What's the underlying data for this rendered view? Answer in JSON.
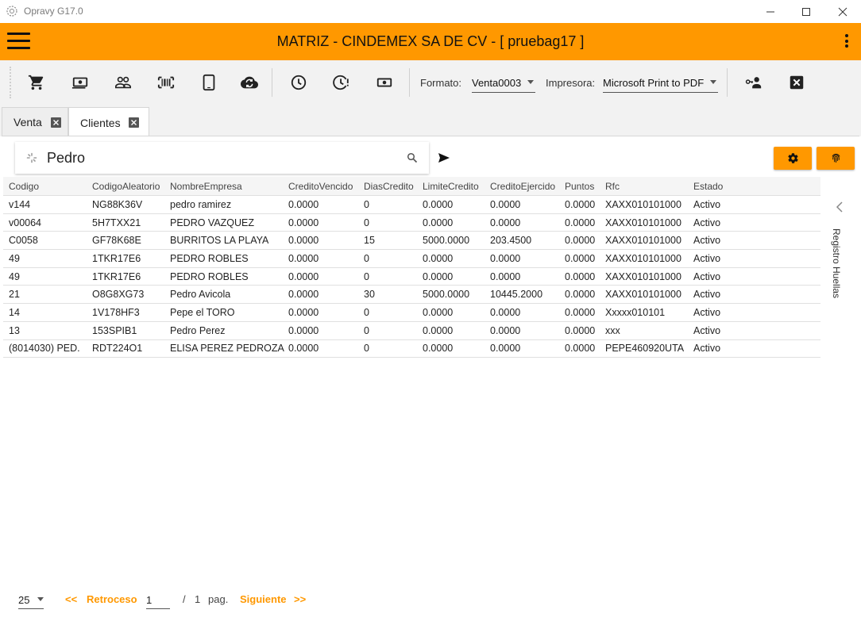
{
  "window": {
    "title": "Opravy G17.0"
  },
  "header": {
    "title": "MATRIZ - CINDEMEX SA DE CV - [ pruebag17 ]"
  },
  "toolbar": {
    "formato_label": "Formato:",
    "formato_value": "Venta0003",
    "impresora_label": "Impresora:",
    "impresora_value": "Microsoft Print to PDF"
  },
  "tabs": [
    {
      "label": "Venta",
      "active": false
    },
    {
      "label": "Clientes",
      "active": true
    }
  ],
  "search": {
    "value": "Pedro",
    "placeholder": ""
  },
  "table": {
    "columns": [
      "Codigo",
      "CodigoAleatorio",
      "NombreEmpresa",
      "CreditoVencido",
      "DiasCredito",
      "LimiteCredito",
      "CreditoEjercido",
      "Puntos",
      "Rfc",
      "Estado"
    ],
    "rows": [
      [
        "v144",
        "NG88K36V",
        "pedro ramirez",
        "0.0000",
        "0",
        "0.0000",
        "0.0000",
        "0.0000",
        "XAXX010101000",
        "Activo"
      ],
      [
        "v00064",
        "5H7TXX21",
        "PEDRO VAZQUEZ",
        "0.0000",
        "0",
        "0.0000",
        "0.0000",
        "0.0000",
        "XAXX010101000",
        "Activo"
      ],
      [
        "C0058",
        "GF78K68E",
        "BURRITOS LA PLAYA",
        "0.0000",
        "15",
        "5000.0000",
        "203.4500",
        "0.0000",
        "XAXX010101000",
        "Activo"
      ],
      [
        "49",
        "1TKR17E6",
        "PEDRO ROBLES",
        "0.0000",
        "0",
        "0.0000",
        "0.0000",
        "0.0000",
        "XAXX010101000",
        "Activo"
      ],
      [
        "49",
        "1TKR17E6",
        "PEDRO ROBLES",
        "0.0000",
        "0",
        "0.0000",
        "0.0000",
        "0.0000",
        "XAXX010101000",
        "Activo"
      ],
      [
        "21",
        "O8G8XG73",
        "Pedro Avicola",
        "0.0000",
        "30",
        "5000.0000",
        "10445.2000",
        "0.0000",
        "XAXX010101000",
        "Activo"
      ],
      [
        "14",
        "1V178HF3",
        "Pepe el TORO",
        "0.0000",
        "0",
        "0.0000",
        "0.0000",
        "0.0000",
        "Xxxxx010101",
        "Activo"
      ],
      [
        "13",
        "153SPIB1",
        "Pedro Perez",
        "0.0000",
        "0",
        "0.0000",
        "0.0000",
        "0.0000",
        "xxx",
        "Activo"
      ],
      [
        "(8014030) PED.",
        "RDT224O1",
        "ELISA PEREZ PEDROZA",
        "0.0000",
        "0",
        "0.0000",
        "0.0000",
        "0.0000",
        "PEPE460920UTA",
        "Activo"
      ]
    ]
  },
  "side_panel": {
    "label": "Registro Huellas"
  },
  "pagination": {
    "page_size": "25",
    "prev_arrows": "<<",
    "prev_label": "Retroceso",
    "current_page": "1",
    "of_label": "/",
    "total_pages": "1",
    "pag_label": "pag.",
    "next_label": "Siguiente",
    "next_arrows": ">>"
  },
  "colors": {
    "accent": "#ff9800",
    "toolbar_bg": "#f2f2f2",
    "header_text": "#111111"
  },
  "icons": [
    "app-icon",
    "menu-icon",
    "cart-icon",
    "cash-icon",
    "customers-icon",
    "barcode-icon",
    "tablet-icon",
    "cloud-sync-icon",
    "clock-icon",
    "clock-alert-icon",
    "money-icon",
    "user-key-icon",
    "close-box-icon",
    "search-icon",
    "send-icon",
    "gear-icon",
    "fingerprint-icon",
    "chevron-left-icon"
  ]
}
